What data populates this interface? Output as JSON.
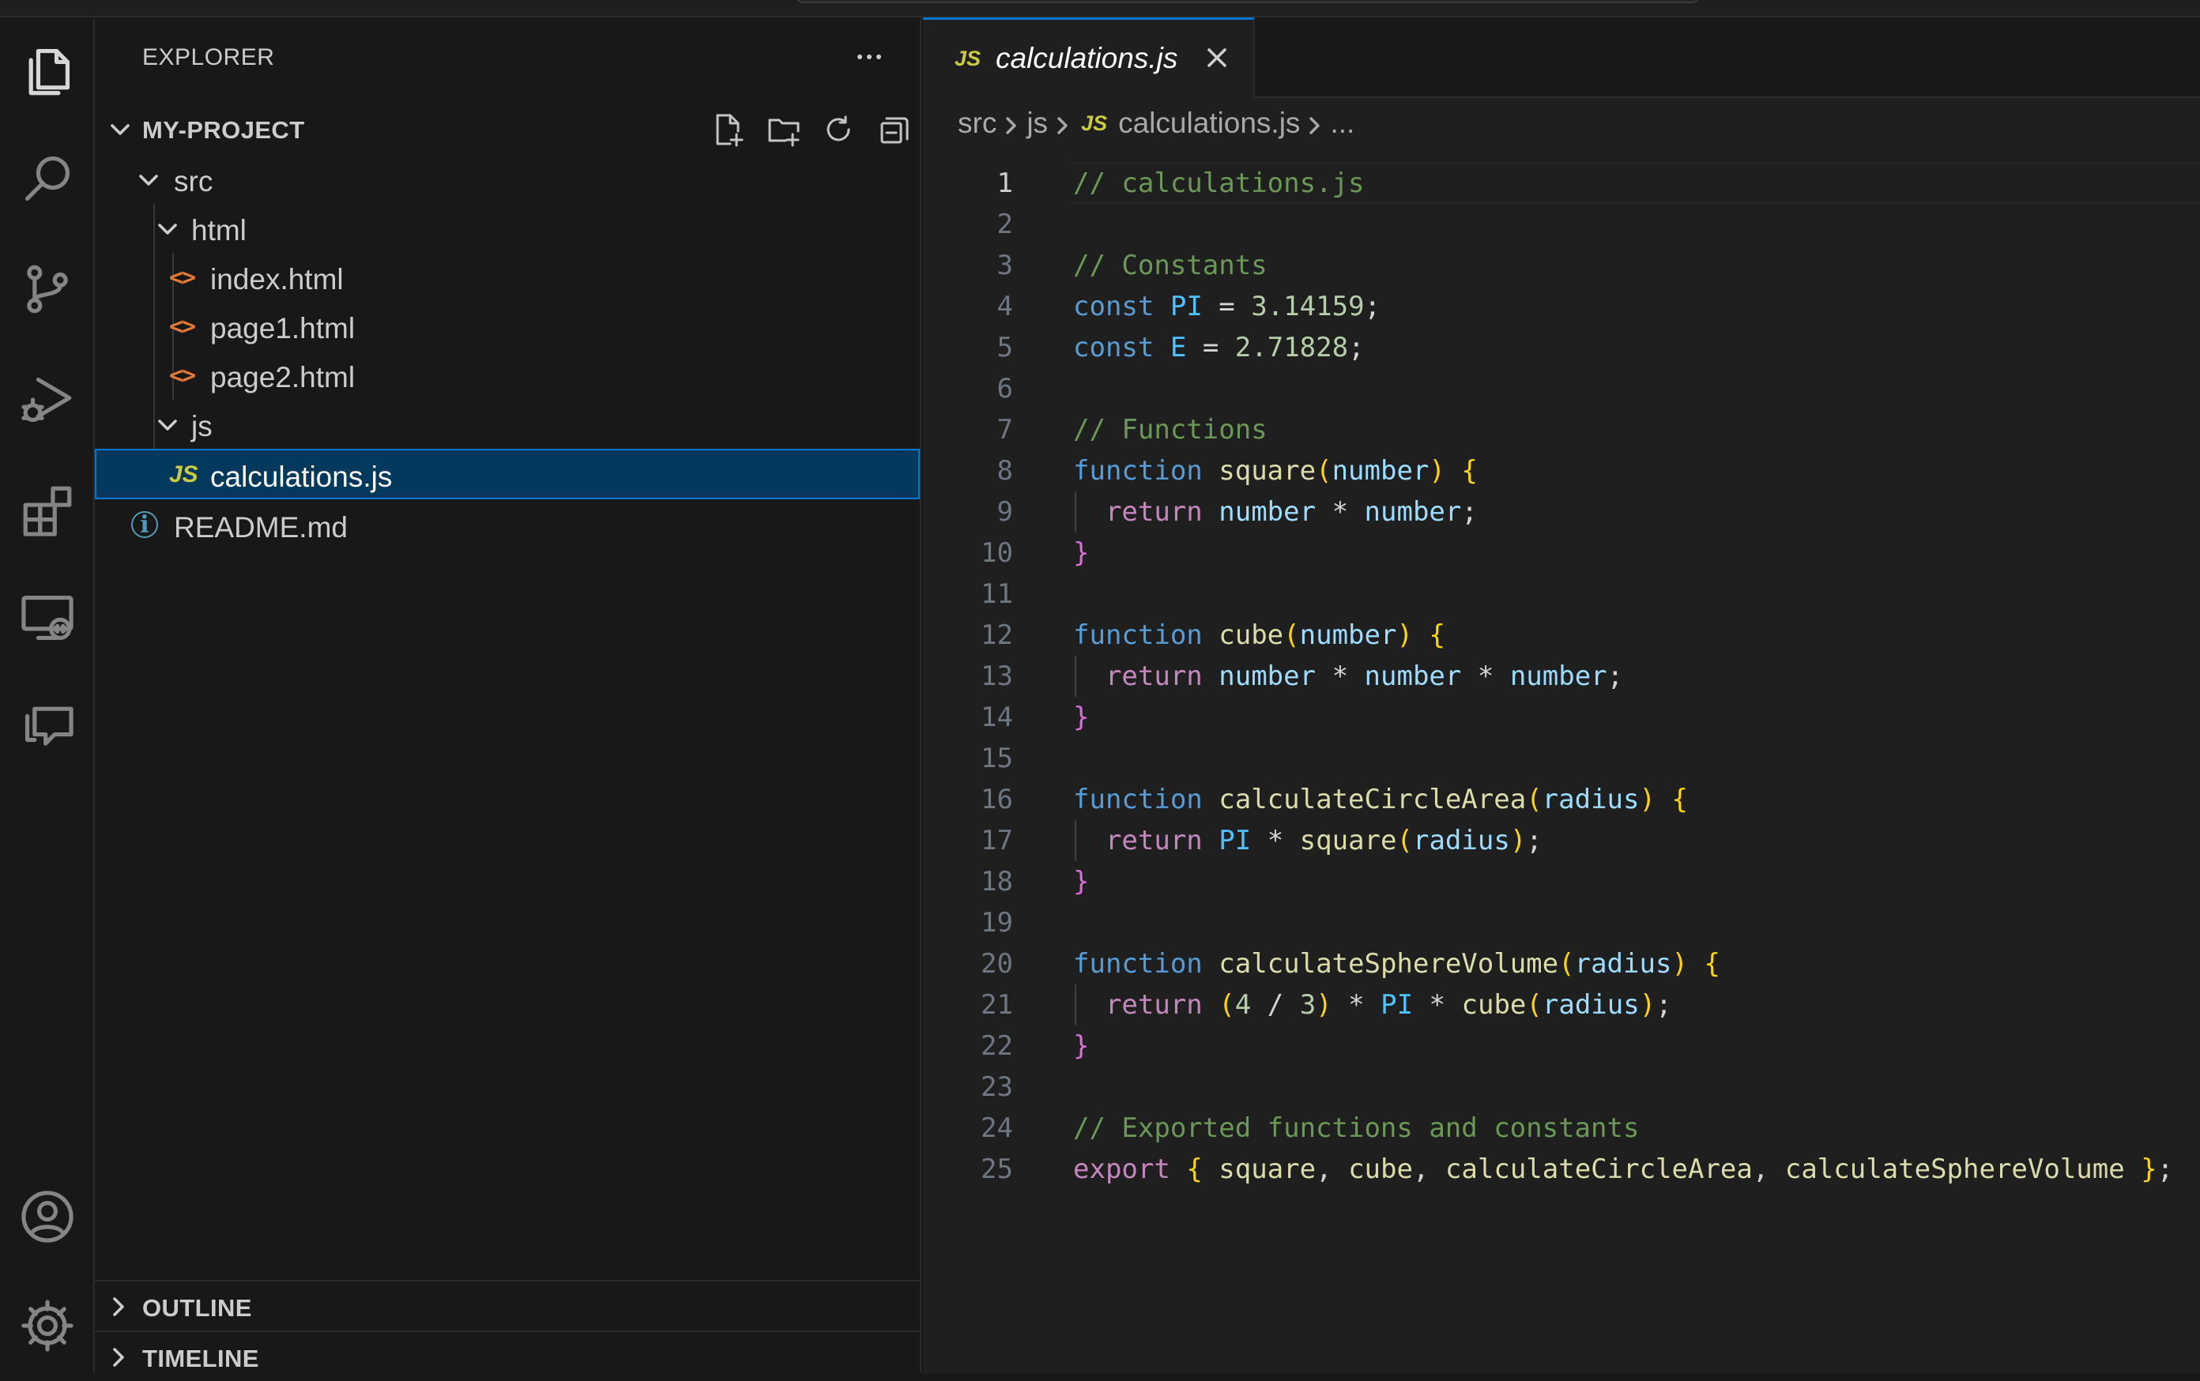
{
  "sidebar": {
    "title": "EXPLORER",
    "more_actions": "···",
    "project": {
      "name": "MY-PROJECT",
      "actions": [
        "new-file",
        "new-folder",
        "refresh",
        "collapse-all"
      ]
    },
    "tree": [
      {
        "label": "src",
        "type": "folder",
        "expanded": true,
        "depth": 0
      },
      {
        "label": "html",
        "type": "folder",
        "expanded": true,
        "depth": 1
      },
      {
        "label": "index.html",
        "type": "file",
        "icon": "<>",
        "depth": 2
      },
      {
        "label": "page1.html",
        "type": "file",
        "icon": "<>",
        "depth": 2
      },
      {
        "label": "page2.html",
        "type": "file",
        "icon": "<>",
        "depth": 2
      },
      {
        "label": "js",
        "type": "folder",
        "expanded": true,
        "depth": 1
      },
      {
        "label": "calculations.js",
        "type": "file",
        "icon": "JS",
        "depth": 2,
        "selected": true
      },
      {
        "label": "README.md",
        "type": "file",
        "icon": "i",
        "depth": 0
      }
    ],
    "outline_label": "OUTLINE",
    "timeline_label": "TIMELINE"
  },
  "editor": {
    "tab": {
      "icon": "JS",
      "label": "calculations.js"
    },
    "breadcrumb": {
      "parts": [
        "src",
        "js"
      ],
      "file_icon": "JS",
      "file": "calculations.js",
      "tail": "..."
    },
    "current_line": 1,
    "line_numbers": [
      "1",
      "2",
      "3",
      "4",
      "5",
      "6",
      "7",
      "8",
      "9",
      "10",
      "11",
      "12",
      "13",
      "14",
      "15",
      "16",
      "17",
      "18",
      "19",
      "20",
      "21",
      "22",
      "23",
      "24",
      "25"
    ],
    "code_lines": [
      "// calculations.js",
      "",
      "// Constants",
      "const PI = 3.14159;",
      "const E = 2.71828;",
      "",
      "// Functions",
      "function square(number) {",
      "  return number * number;",
      "}",
      "",
      "function cube(number) {",
      "  return number * number * number;",
      "}",
      "",
      "function calculateCircleArea(radius) {",
      "  return PI * square(radius);",
      "}",
      "",
      "function calculateSphereVolume(radius) {",
      "  return (4 / 3) * PI * cube(radius);",
      "}",
      "",
      "// Exported functions and constants",
      "export { square, cube, calculateCircleArea, calculateSphereVolume };"
    ]
  },
  "activity_bar": {
    "top_icons": [
      "files-icon",
      "search-icon",
      "source-control-icon",
      "run-debug-icon",
      "extensions-icon",
      "remote-explorer-icon",
      "chat-icon"
    ],
    "bottom_icons": [
      "account-icon",
      "settings-gear-icon"
    ]
  },
  "colors": {
    "accent": "#0078d4",
    "selection": "#04395e",
    "comment": "#6a9955",
    "keyword": "#569cd6",
    "function": "#dcdcaa",
    "variable": "#9cdcfe",
    "number": "#b5cea8",
    "html_icon": "#e37933",
    "js_icon": "#cbcb41"
  }
}
